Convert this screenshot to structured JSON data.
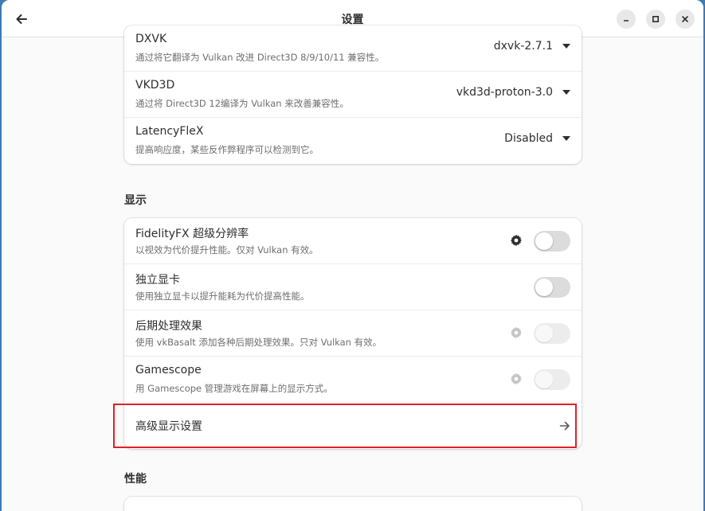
{
  "window": {
    "title": "设置"
  },
  "compat_card": {
    "rows": [
      {
        "title": "DXVK",
        "subtitle": "通过将它翻译为 Vulkan 改进 Direct3D 8/9/10/11 兼容性。",
        "value": "dxvk-2.7.1"
      },
      {
        "title": "VKD3D",
        "subtitle": "通过将 Direct3D 12编译为 Vulkan 来改善兼容性。",
        "value": "vkd3d-proton-3.0"
      },
      {
        "title": "LatencyFleX",
        "subtitle": "提高响应度，某些反作弊程序可以检测到它。",
        "value": "Disabled"
      }
    ]
  },
  "display_section": {
    "heading": "显示",
    "rows": [
      {
        "title": "FidelityFX 超级分辨率",
        "subtitle": "以视效为代价提升性能。仅对 Vulkan 有效。",
        "enabled": false,
        "interactive": true
      },
      {
        "title": "独立显卡",
        "subtitle": "使用独立显卡以提升能耗为代价提高性能。",
        "enabled": false,
        "interactive": true
      },
      {
        "title": "后期处理效果",
        "subtitle": "使用 vkBasalt 添加各种后期处理效果。只对 Vulkan 有效。",
        "enabled": false,
        "interactive": false
      },
      {
        "title": "Gamescope",
        "subtitle": "用 Gamescope 管理游戏在屏幕上的显示方式。",
        "enabled": false,
        "interactive": false
      }
    ],
    "advanced_label": "高级显示设置"
  },
  "performance_section": {
    "heading": "性能"
  },
  "colors": {
    "accent_highlight": "#e0202a",
    "desktop_bg": "#3d7ab8"
  },
  "icons": {
    "back": "arrow-left-icon",
    "minimize": "minimize-icon",
    "maximize": "maximize-icon",
    "close": "close-icon",
    "settings": "gear-icon",
    "next": "arrow-right-icon",
    "dropdown": "caret-down-icon"
  }
}
